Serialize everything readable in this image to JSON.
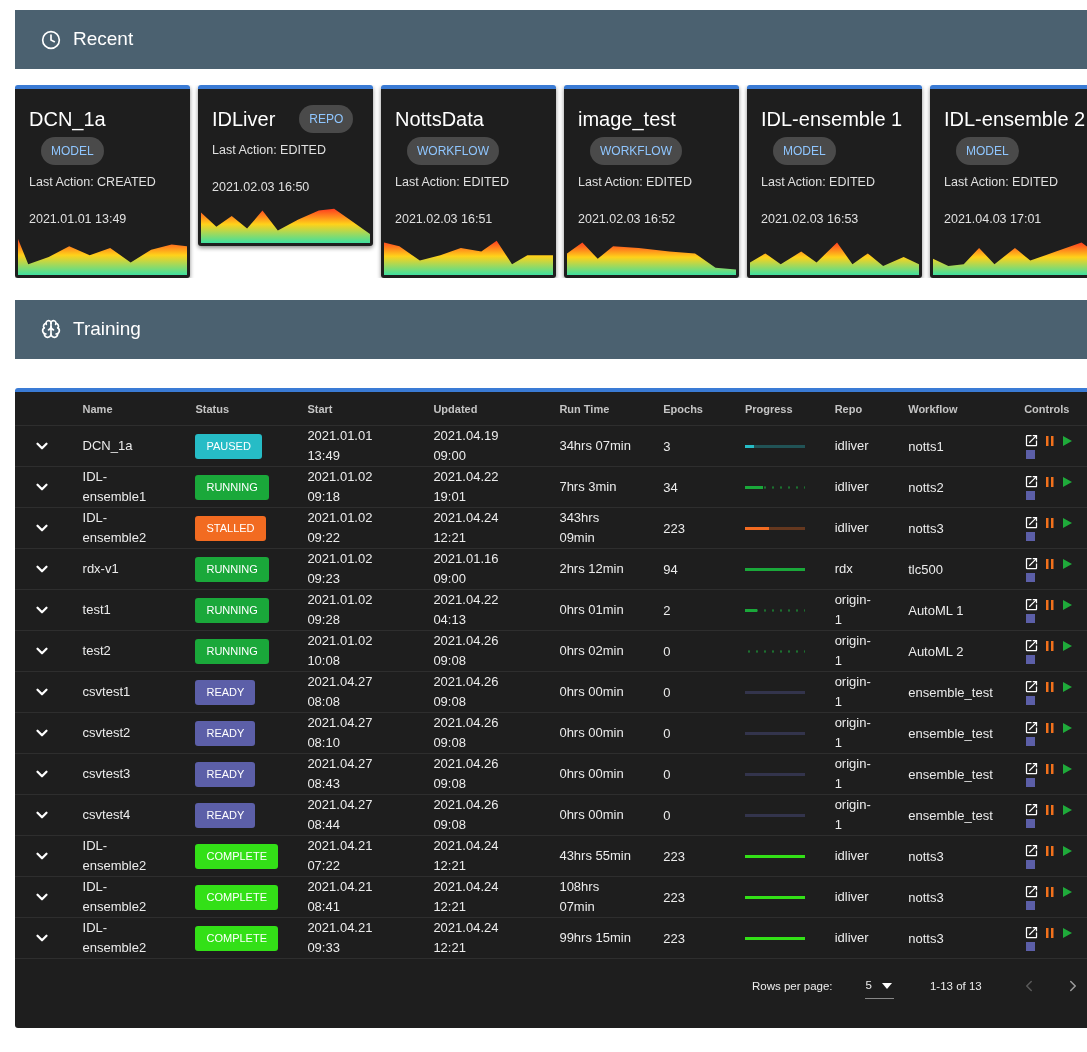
{
  "recent": {
    "title": "Recent",
    "cards": [
      {
        "title": "DCN_1a",
        "tag": "MODEL",
        "last_action": "Last Action: CREATED",
        "date": "2021.01.01 13:49"
      },
      {
        "title": "IDLiver",
        "tag": "REPO",
        "last_action": "Last Action: EDITED",
        "date": "2021.02.03 16:50"
      },
      {
        "title": "NottsData",
        "tag": "WORKFLOW",
        "last_action": "Last Action: EDITED",
        "date": "2021.02.03 16:51"
      },
      {
        "title": "image_test",
        "tag": "WORKFLOW",
        "last_action": "Last Action: EDITED",
        "date": "2021.02.03 16:52"
      },
      {
        "title": "IDL-ensemble 1",
        "tag": "MODEL",
        "last_action": "Last Action: EDITED",
        "date": "2021.02.03 16:53"
      },
      {
        "title": "IDL-ensemble 2",
        "tag": "MODEL",
        "last_action": "Last Action: EDITED",
        "date": "2021.04.03 17:01"
      }
    ]
  },
  "training": {
    "title": "Training",
    "table": {
      "columns": [
        "Name",
        "Status",
        "Start",
        "Updated",
        "Run Time",
        "Epochs",
        "Progress",
        "Repo",
        "Workflow",
        "Controls"
      ],
      "rows": [
        {
          "name": "DCN_1a",
          "status": {
            "label": "PAUSED",
            "color": "#26bcc6"
          },
          "start": "2021.01.01 13:49",
          "updated": "2021.04.19 09:00",
          "run_time": "34hrs 07min",
          "epochs": "3",
          "progress": {
            "kind": "solid",
            "level": 0.15
          },
          "repo": "idliver",
          "workflow": "notts1"
        },
        {
          "name": "IDL-ensemble1",
          "status": {
            "label": "RUNNING",
            "color": "#1aa83a"
          },
          "start": "2021.01.02 09:18",
          "updated": "2021.04.22 19:01",
          "run_time": "7hrs 3min",
          "epochs": "34",
          "progress": {
            "kind": "buffer",
            "level": 0.3
          },
          "repo": "idliver",
          "workflow": "notts2"
        },
        {
          "name": "IDL-ensemble2",
          "status": {
            "label": "STALLED",
            "color": "#f26b21"
          },
          "start": "2021.01.02 09:22",
          "updated": "2021.04.24 12:21",
          "run_time": "343hrs 09min",
          "epochs": "223",
          "progress": {
            "kind": "solid",
            "level": 0.4
          },
          "repo": "idliver",
          "workflow": "notts3"
        },
        {
          "name": "rdx-v1",
          "status": {
            "label": "RUNNING",
            "color": "#1aa83a"
          },
          "start": "2021.01.02 09:23",
          "updated": "2021.01.16 09:00",
          "run_time": "2hrs 12min",
          "epochs": "94",
          "progress": {
            "kind": "buffer",
            "level": 1
          },
          "repo": "rdx",
          "workflow": "tlc500"
        },
        {
          "name": "test1",
          "status": {
            "label": "RUNNING",
            "color": "#1aa83a"
          },
          "start": "2021.01.02 09:28",
          "updated": "2021.04.22 04:13",
          "run_time": "0hrs 01min",
          "epochs": "2",
          "progress": {
            "kind": "buffer",
            "level": 0.2
          },
          "repo": "origin-1",
          "workflow": "AutoML 1"
        },
        {
          "name": "test2",
          "status": {
            "label": "RUNNING",
            "color": "#1aa83a"
          },
          "start": "2021.01.02 10:08",
          "updated": "2021.04.26 09:08",
          "run_time": "0hrs 02min",
          "epochs": "0",
          "progress": {
            "kind": "buffer",
            "level": 0
          },
          "repo": "origin-1",
          "workflow": "AutoML 2"
        },
        {
          "name": "csvtest1",
          "status": {
            "label": "READY",
            "color": "#5c5fa8"
          },
          "start": "2021.04.27 08:08",
          "updated": "2021.04.26 09:08",
          "run_time": "0hrs 00min",
          "epochs": "0",
          "progress": {
            "kind": "solid",
            "level": 0
          },
          "repo": "origin-1",
          "workflow": "ensemble_test"
        },
        {
          "name": "csvtest2",
          "status": {
            "label": "READY",
            "color": "#5c5fa8"
          },
          "start": "2021.04.27 08:10",
          "updated": "2021.04.26 09:08",
          "run_time": "0hrs 00min",
          "epochs": "0",
          "progress": {
            "kind": "solid",
            "level": 0
          },
          "repo": "origin-1",
          "workflow": "ensemble_test"
        },
        {
          "name": "csvtest3",
          "status": {
            "label": "READY",
            "color": "#5c5fa8"
          },
          "start": "2021.04.27 08:43",
          "updated": "2021.04.26 09:08",
          "run_time": "0hrs 00min",
          "epochs": "0",
          "progress": {
            "kind": "solid",
            "level": 0
          },
          "repo": "origin-1",
          "workflow": "ensemble_test"
        },
        {
          "name": "csvtest4",
          "status": {
            "label": "READY",
            "color": "#5c5fa8"
          },
          "start": "2021.04.27 08:44",
          "updated": "2021.04.26 09:08",
          "run_time": "0hrs 00min",
          "epochs": "0",
          "progress": {
            "kind": "solid",
            "level": 0
          },
          "repo": "origin-1",
          "workflow": "ensemble_test"
        },
        {
          "name": "IDL-ensemble2",
          "status": {
            "label": "COMPLETE",
            "color": "#33e017"
          },
          "start": "2021.04.21 07:22",
          "updated": "2021.04.24 12:21",
          "run_time": "43hrs 55min",
          "epochs": "223",
          "progress": {
            "kind": "solid",
            "level": 1
          },
          "repo": "idliver",
          "workflow": "notts3"
        },
        {
          "name": "IDL-ensemble2",
          "status": {
            "label": "COMPLETE",
            "color": "#33e017"
          },
          "start": "2021.04.21 08:41",
          "updated": "2021.04.24 12:21",
          "run_time": "108hrs 07min",
          "epochs": "223",
          "progress": {
            "kind": "solid",
            "level": 1
          },
          "repo": "idliver",
          "workflow": "notts3"
        },
        {
          "name": "IDL-ensemble2",
          "status": {
            "label": "COMPLETE",
            "color": "#33e017"
          },
          "start": "2021.04.21 09:33",
          "updated": "2021.04.24 12:21",
          "run_time": "99hrs 15min",
          "epochs": "223",
          "progress": {
            "kind": "solid",
            "level": 1
          },
          "repo": "idliver",
          "workflow": "notts3"
        }
      ]
    },
    "pagination": {
      "rows_per_page_label": "Rows per page:",
      "rows_per_page": "5",
      "range": "1-13 of 13",
      "prev_disabled": true,
      "next_disabled": false
    }
  }
}
